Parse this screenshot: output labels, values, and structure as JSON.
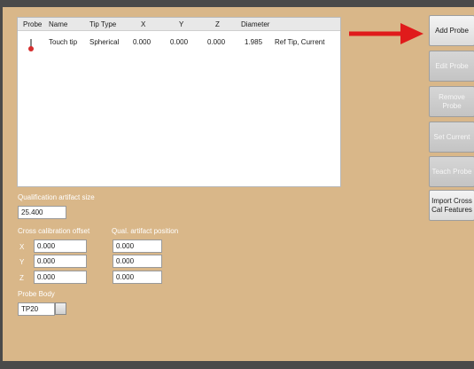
{
  "colors": {
    "background": "#d9b789",
    "arrow": "#e01b1b",
    "probe_tip": "#d62e2e"
  },
  "table": {
    "columns": [
      "Probe",
      "Name",
      "Tip Type",
      "X",
      "Y",
      "Z",
      "Diameter"
    ],
    "rows": [
      {
        "icon": "probe-icon",
        "name": "Touch tip",
        "tip_type": "Spherical",
        "x": "0.000",
        "y": "0.000",
        "z": "0.000",
        "diameter": "1.985",
        "status": "Ref Tip, Current"
      }
    ]
  },
  "qualification": {
    "label": "Qualification artifact size",
    "value": "25.400"
  },
  "cross_cal": {
    "label": "Cross calibration offset",
    "axes": [
      "X",
      "Y",
      "Z"
    ],
    "values": [
      "0.000",
      "0.000",
      "0.000"
    ]
  },
  "artifact_position": {
    "label": "Qual. artifact position",
    "values": [
      "0.000",
      "0.000",
      "0.000"
    ]
  },
  "probe_body": {
    "label": "Probe Body",
    "value": "TP20"
  },
  "buttons": {
    "add_probe": "Add Probe",
    "edit_probe": "Edit Probe",
    "remove_probe": "Remove Probe",
    "set_current": "Set Current",
    "teach_probe": "Teach Probe",
    "import_cross": "Import Cross Cal Features"
  }
}
